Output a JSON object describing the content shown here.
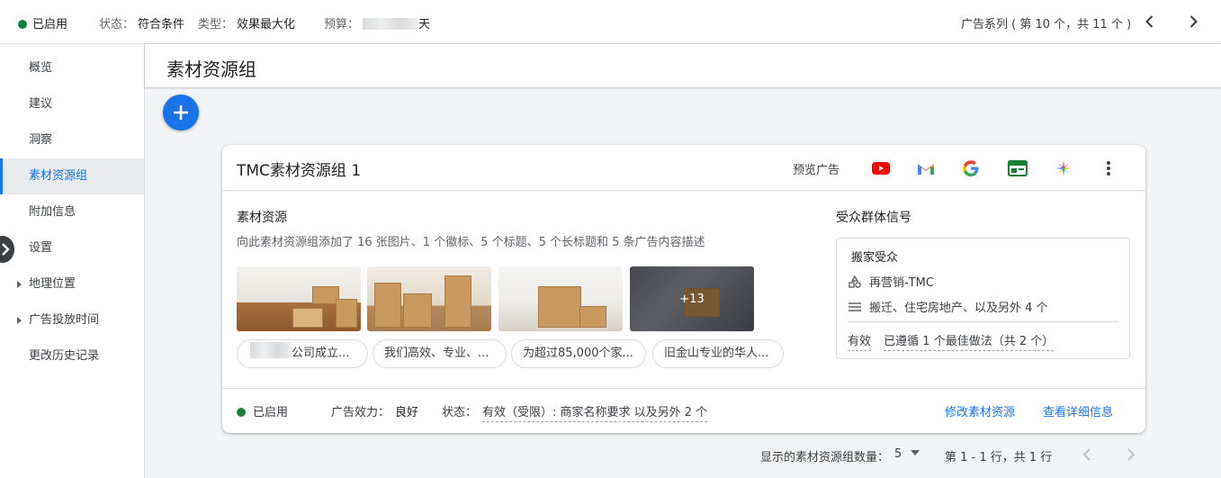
{
  "topbar": {
    "status": "已启用",
    "state_label": "状态：",
    "state_value": "符合条件",
    "type_label": "类型：",
    "type_value": "效果最大化",
    "budget_label": "预算：",
    "budget_suffix": "天",
    "campaign_nav": "广告系列 ( 第 10 个，共 11 个 )",
    "status_color": "#188038"
  },
  "sidebar": {
    "items": [
      {
        "label": "概览"
      },
      {
        "label": "建议"
      },
      {
        "label": "洞察"
      },
      {
        "label": "素材资源组"
      },
      {
        "label": "附加信息"
      },
      {
        "label": "设置"
      },
      {
        "label": "地理位置"
      },
      {
        "label": "广告投放时间"
      },
      {
        "label": "更改历史记录"
      }
    ],
    "active": "素材资源组"
  },
  "header": {
    "title": "素材资源组"
  },
  "card": {
    "title": "TMC素材资源组 1",
    "preview_label": "预览广告",
    "preview_icons": [
      "youtube-icon",
      "gmail-icon",
      "google-icon",
      "display-icon",
      "discover-icon",
      "more-vert-icon"
    ],
    "assets": {
      "title": "素材资源",
      "description": "向此素材资源组添加了 16 张图片、1 个徽标、5 个标题、5 个长标题和 5 条广告内容描述",
      "more_count": "+13",
      "headlines": [
        "公司成立...",
        "我们高效、专业、...",
        "为超过85,000个家...",
        "旧金山专业的华人..."
      ]
    },
    "audience": {
      "title": "受众群体信号",
      "name": "搬家受众",
      "segment": "再营销-TMC",
      "interests": "搬迁、住宅房地产、以及另外 4 个",
      "status": "有效",
      "best_practice": "已遵循 1 个最佳做法（共 2 个）"
    },
    "footer": {
      "status": "已启用",
      "strength_label": "广告效力：",
      "strength_value": "良好",
      "state_label": "状态：",
      "state_value": "有效（受限）: 商家名称要求 以及另外 2 个",
      "edit_link": "修改素材资源",
      "details_link": "查看详细信息"
    }
  },
  "pagination": {
    "rows_label": "显示的素材资源组数量：",
    "rows_value": "5",
    "range": "第 1 - 1 行，共 1 行"
  },
  "colors": {
    "accent": "#1a73e8",
    "success": "#188038"
  }
}
